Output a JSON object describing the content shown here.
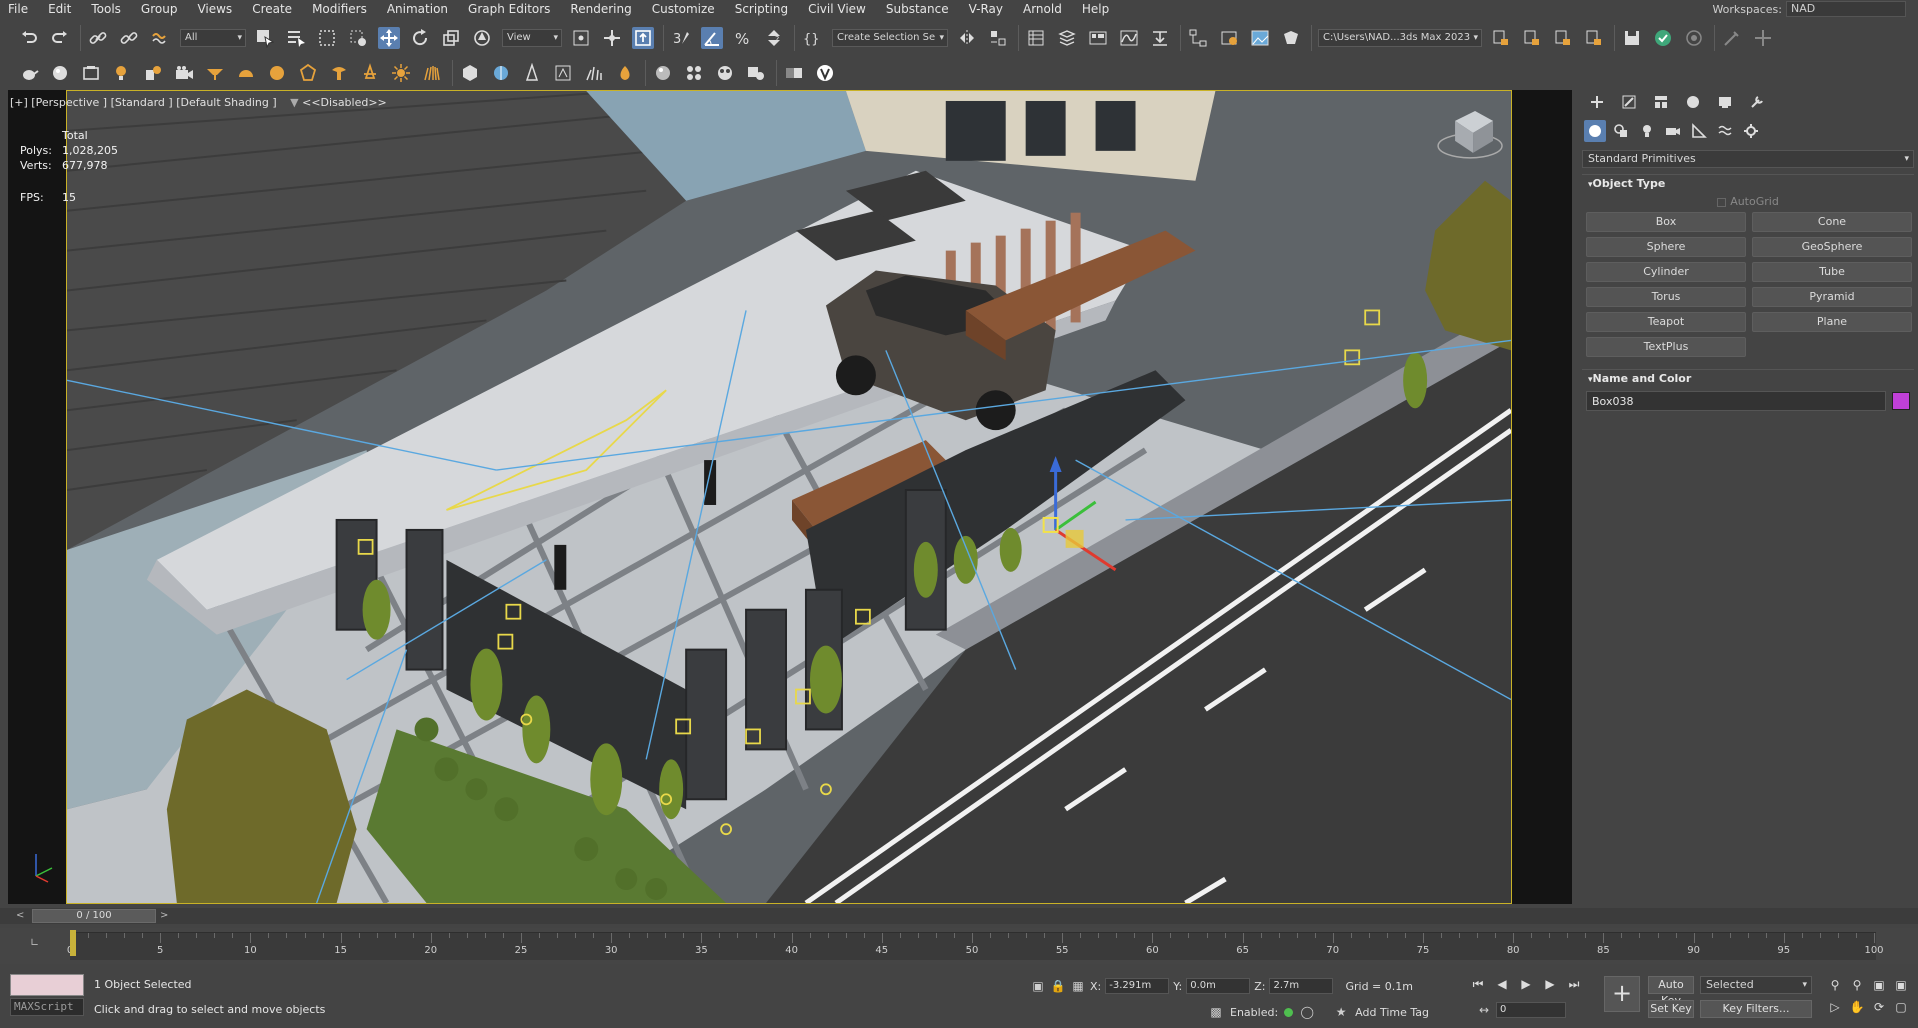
{
  "menu": [
    "File",
    "Edit",
    "Tools",
    "Group",
    "Views",
    "Create",
    "Modifiers",
    "Animation",
    "Graph Editors",
    "Rendering",
    "Customize",
    "Scripting",
    "Civil View",
    "Substance",
    "V-Ray",
    "Arnold",
    "Help"
  ],
  "workspace": {
    "label": "Workspaces:",
    "value": "NAD"
  },
  "toolbar": {
    "filter_dropdown": "All",
    "ref_coord_dropdown": "View",
    "selection_set_dropdown": "Create Selection Se",
    "project_path": "C:\\Users\\NAD...3ds Max 2023"
  },
  "viewport": {
    "label": "[+] [Perspective ] [Standard ] [Default Shading ]",
    "filter_label": "<<Disabled>>",
    "stats": {
      "total_label": "Total",
      "polys_label": "Polys:",
      "polys_value": "1,028,205",
      "verts_label": "Verts:",
      "verts_value": "677,978",
      "fps_label": "FPS:",
      "fps_value": "15"
    }
  },
  "command_panel": {
    "primitives_dropdown": "Standard Primitives",
    "object_type_title": "Object Type",
    "autogrid_label": "AutoGrid",
    "primitives": [
      "Box",
      "Cone",
      "Sphere",
      "GeoSphere",
      "Cylinder",
      "Tube",
      "Torus",
      "Pyramid",
      "Teapot",
      "Plane",
      "TextPlus"
    ],
    "name_color_title": "Name and Color",
    "object_name": "Box038",
    "object_color": "#c040d8"
  },
  "timeline": {
    "frame_display": "0 / 100",
    "prev_arrow": "<",
    "next_arrow": ">",
    "ticks": [
      "0",
      "5",
      "10",
      "15",
      "20",
      "25",
      "30",
      "35",
      "40",
      "45",
      "50",
      "55",
      "60",
      "65",
      "70",
      "75",
      "80",
      "85",
      "90",
      "95",
      "100"
    ]
  },
  "status": {
    "maxscript_label": "MAXScript",
    "selection_text": "1 Object Selected",
    "prompt_text": "Click and drag to select and move objects",
    "x_label": "X:",
    "x_value": "-3.291m",
    "y_label": "Y:",
    "y_value": "0.0m",
    "z_label": "Z:",
    "z_value": "2.7m",
    "grid_text": "Grid = 0.1m",
    "enabled_label": "Enabled:",
    "add_time_tag": "Add Time Tag",
    "auto_key": "Auto Key",
    "set_key": "Set Key",
    "key_mode_dropdown": "Selected",
    "key_filters": "Key Filters...",
    "current_frame": "0"
  },
  "colors": {
    "selection_yellow": "#c9b227",
    "active_blue": "#5a7fb0",
    "ui_background": "#444444"
  }
}
